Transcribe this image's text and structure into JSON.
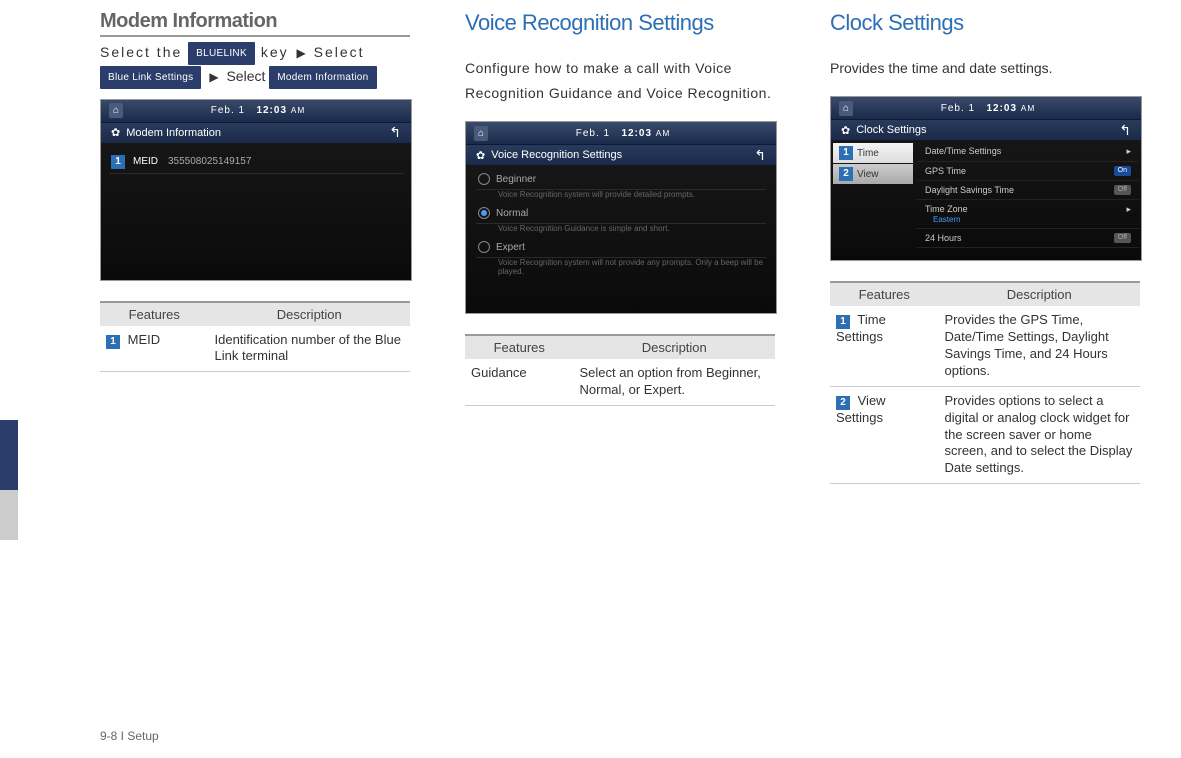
{
  "footer": "9-8 I Setup",
  "col1": {
    "title": "Modem Information",
    "nav": {
      "t1": "Select the ",
      "pill1": "BLUELINK",
      "t2": " key ",
      "arrow": "▶",
      "t3": "Select",
      "pill2": "Blue Link Settings",
      "t4": " Select ",
      "pill3": "Modem Information"
    },
    "screenshot": {
      "date": "Feb. 1",
      "time": "12:03",
      "ampm": "AM",
      "header": "Modem Information",
      "row1_label": "MEID",
      "row1_value": "355508025149157"
    },
    "table": {
      "h1": "Features",
      "h2": "Description",
      "r1_feat": "MEID",
      "r1_desc": "Identification number of the Blue Link terminal"
    }
  },
  "col2": {
    "title": "Voice Recognition Settings",
    "intro": "Configure how to make a call with Voice Recognition Guidance and Voice Recognition.",
    "screenshot": {
      "date": "Feb. 1",
      "time": "12:03",
      "ampm": "AM",
      "header": "Voice Recognition Settings",
      "opt1": "Beginner",
      "opt1_sub": "Voice Recognition system will provide detailed prompts.",
      "opt2": "Normal",
      "opt2_sub": "Voice Recognition Guidance is simple and short.",
      "opt3": "Expert",
      "opt3_sub": "Voice Recognition system will not provide any prompts. Only a beep will be played."
    },
    "table": {
      "h1": "Features",
      "h2": "Description",
      "r1_feat": "Guidance",
      "r1_desc": "Select an option from Beginner, Normal, or Expert."
    }
  },
  "col3": {
    "title": "Clock Settings",
    "intro": "Provides the time and date settings.",
    "screenshot": {
      "date": "Feb. 1",
      "time": "12:03",
      "ampm": "AM",
      "header": "Clock Settings",
      "left1": "Time",
      "left2": "View",
      "right1": "Date/Time Settings",
      "right2": "GPS Time",
      "right2_state": "On",
      "right3": "Daylight Savings Time",
      "right3_state": "Off",
      "right4": "Time Zone",
      "right4_sub": "Eastern",
      "right5": "24 Hours",
      "right5_state": "Off"
    },
    "table": {
      "h1": "Features",
      "h2": "Description",
      "r1_feat": "Time Settings",
      "r1_desc": "Provides the GPS Time, Date/Time Settings, Daylight Savings Time, and 24 Hours options.",
      "r2_feat": "View Settings",
      "r2_desc": "Provides options to select a digital or analog clock widget for the screen saver or home screen, and to select the Display Date settings."
    }
  }
}
